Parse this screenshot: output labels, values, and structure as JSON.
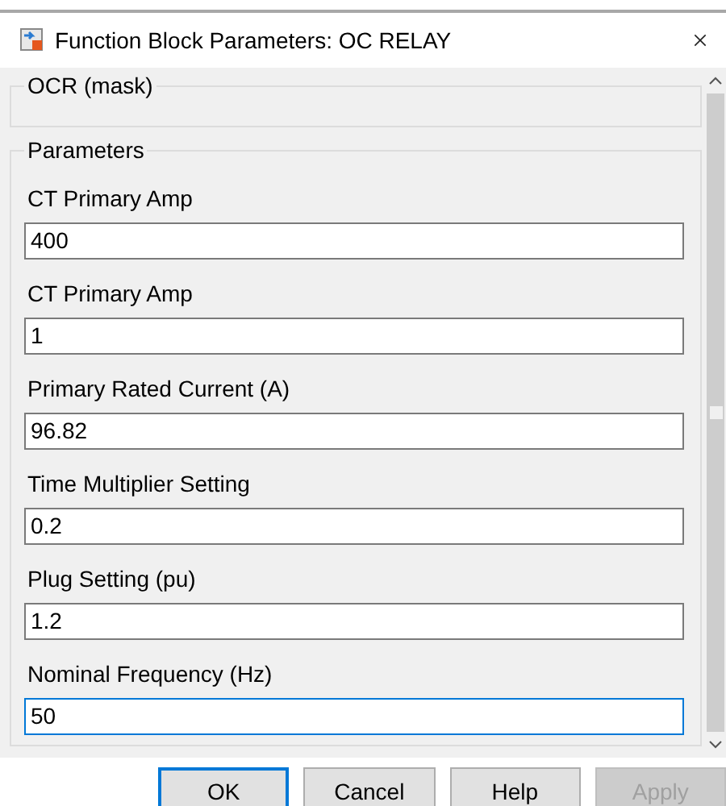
{
  "window": {
    "title": "Function Block Parameters: OC RELAY"
  },
  "mask_group": {
    "title": "OCR (mask)"
  },
  "parameters_group": {
    "title": "Parameters",
    "fields": [
      {
        "label": "CT Primary Amp",
        "value": "400",
        "focused": false
      },
      {
        "label": "CT Primary Amp",
        "value": "1",
        "focused": false
      },
      {
        "label": "Primary Rated Current (A)",
        "value": "96.82",
        "focused": false
      },
      {
        "label": "Time Multiplier Setting",
        "value": "0.2",
        "focused": false
      },
      {
        "label": "Plug Setting (pu)",
        "value": "1.2",
        "focused": false
      },
      {
        "label": "Nominal Frequency (Hz)",
        "value": "50",
        "focused": true
      }
    ]
  },
  "buttons": [
    {
      "label": "OK",
      "focused": true,
      "disabled": false
    },
    {
      "label": "Cancel",
      "focused": false,
      "disabled": false
    },
    {
      "label": "Help",
      "focused": false,
      "disabled": false
    },
    {
      "label": "Apply",
      "focused": false,
      "disabled": true
    }
  ]
}
